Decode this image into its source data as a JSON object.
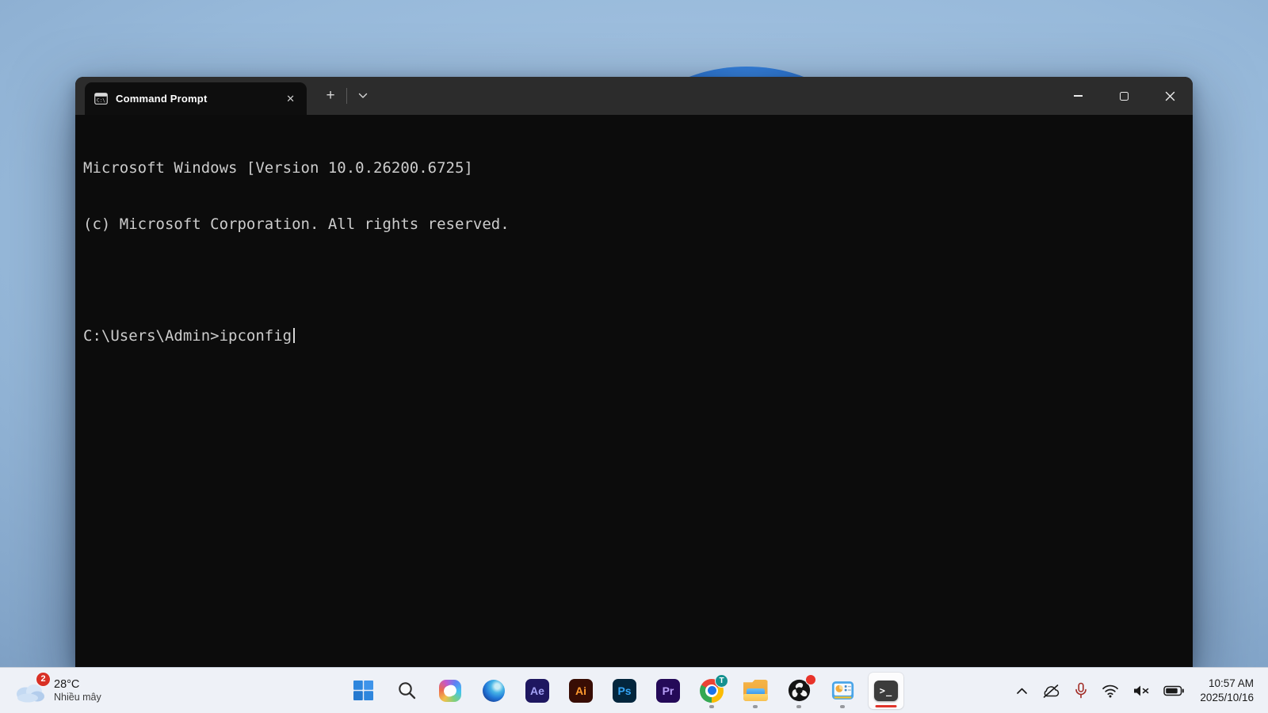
{
  "window": {
    "tab_title": "Command Prompt",
    "glyphs": {
      "tab_close": "✕",
      "new_tab": "+"
    },
    "terminal": {
      "line1": "Microsoft Windows [Version 10.0.26200.6725]",
      "line2": "(c) Microsoft Corporation. All rights reserved.",
      "prompt_line": "C:\\Users\\Admin>ipconfig"
    }
  },
  "taskbar": {
    "weather": {
      "badge": "2",
      "temperature": "28°C",
      "condition": "Nhiều mây"
    },
    "apps": {
      "after_effects": "Ae",
      "illustrator": "Ai",
      "photoshop": "Ps",
      "premiere": "Pr",
      "chrome_badge": "T",
      "terminal_glyph": ">_"
    },
    "clock": {
      "time": "10:57 AM",
      "date": "2025/10/16"
    }
  },
  "colors": {
    "taskbar_bg": "#eef1f7",
    "titlebar_bg": "#2c2c2c",
    "terminal_bg": "#0c0c0c",
    "terminal_text": "#cccccc",
    "active_indicator_red": "#e0342b",
    "wallpaper_sky": "#97b9da",
    "wallpaper_bloom": "#1d66c9"
  }
}
